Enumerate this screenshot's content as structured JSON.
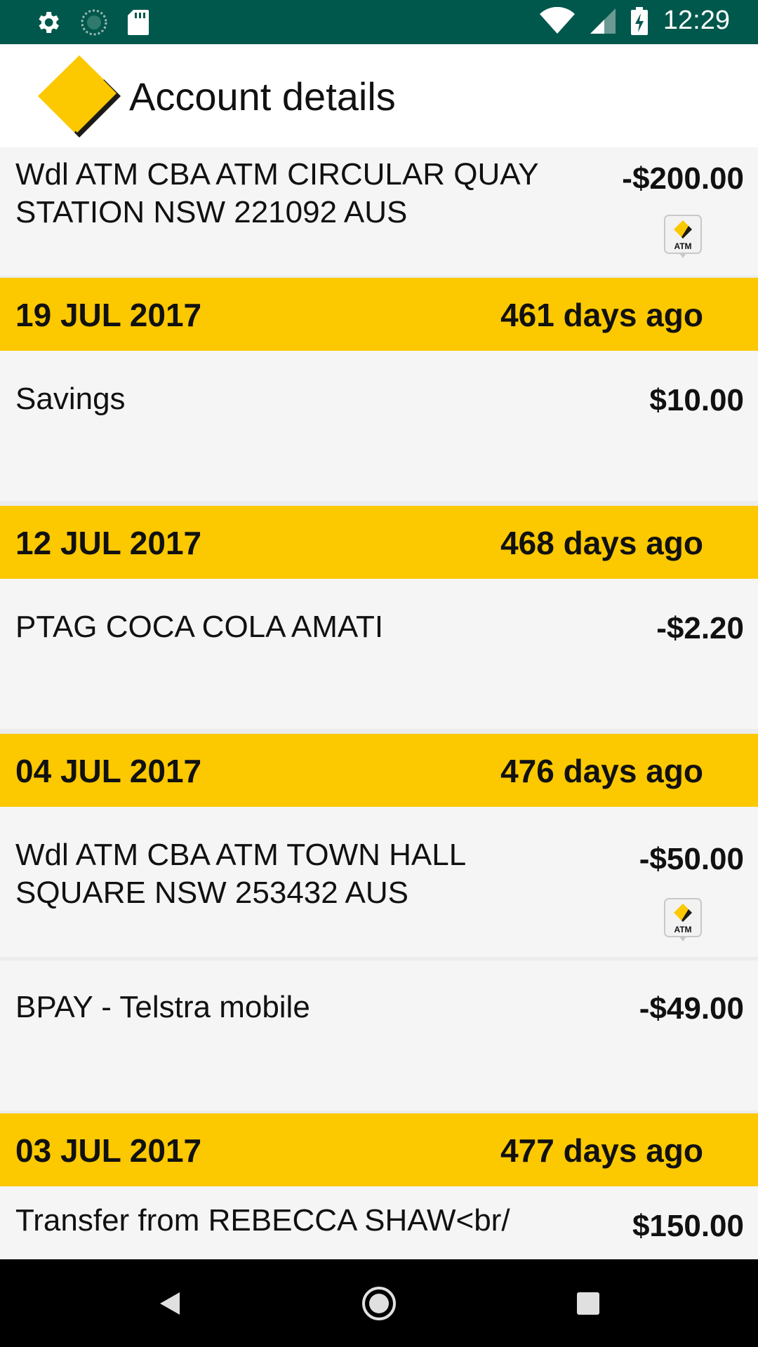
{
  "status_bar": {
    "time": "12:29",
    "left_icons": [
      "gear-icon",
      "sync-icon",
      "sd-card-icon"
    ],
    "right_icons": [
      "wifi-icon",
      "signal-icon",
      "battery-charging-icon"
    ]
  },
  "app_bar": {
    "title": "Account details",
    "logo": "commbank-logo"
  },
  "transactions": [
    {
      "description": "Wdl ATM CBA ATM CIRCULAR QUAY\nSTATION NSW 221092 AUS",
      "amount": "-$200.00",
      "icon": "atm-icon"
    },
    {
      "header_date": "19 JUL 2017",
      "header_ago": "461 days ago"
    },
    {
      "description": "Savings",
      "amount": "$10.00"
    },
    {
      "header_date": "12 JUL 2017",
      "header_ago": "468 days ago"
    },
    {
      "description": "PTAG COCA COLA AMATI",
      "amount": "-$2.20"
    },
    {
      "header_date": "04 JUL 2017",
      "header_ago": "476 days ago"
    },
    {
      "description": "Wdl ATM CBA ATM TOWN HALL\nSQUARE NSW 253432 AUS",
      "amount": "-$50.00",
      "icon": "atm-icon"
    },
    {
      "description": "BPAY - Telstra mobile",
      "amount": "-$49.00"
    },
    {
      "header_date": "03 JUL 2017",
      "header_ago": "477 days ago"
    },
    {
      "description": "Transfer from REBECCA SHAW<br/",
      "amount": "$150.00"
    }
  ],
  "atm_label": "ATM",
  "colors": {
    "status_bar": "#00584c",
    "date_header": "#fcc800",
    "row_bg": "#f5f5f5",
    "logo_yellow": "#fcc800"
  },
  "nav_bar": {
    "back": "back-icon",
    "home": "home-icon",
    "recents": "recents-icon"
  }
}
